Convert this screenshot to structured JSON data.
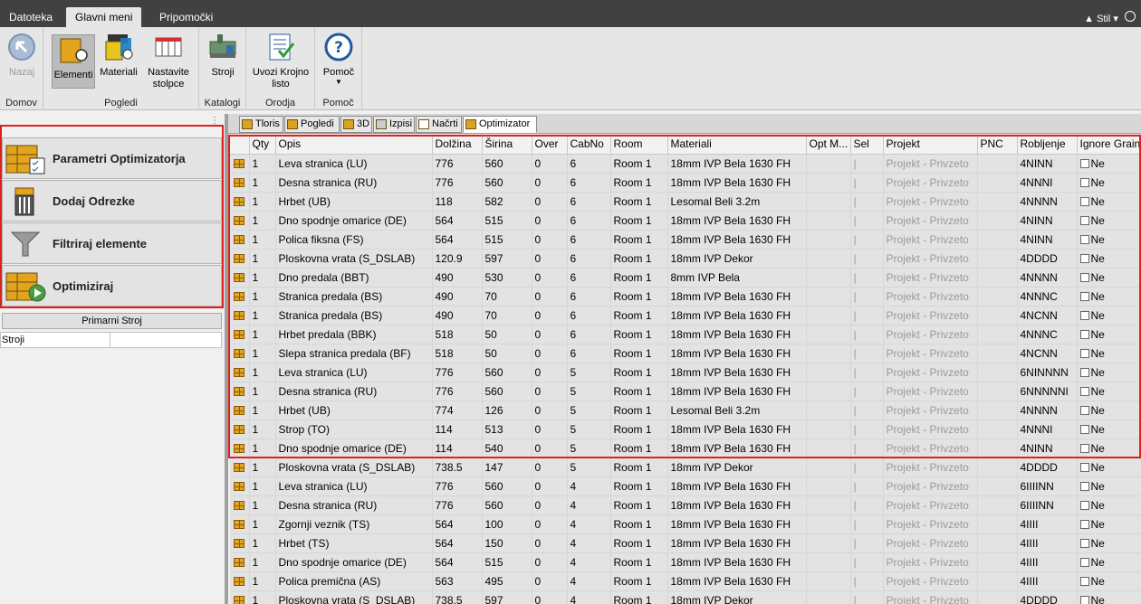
{
  "menubar": {
    "tabs": [
      {
        "label": "Datoteka",
        "active": false
      },
      {
        "label": "Glavni meni",
        "active": true
      },
      {
        "label": "Pripomočki",
        "active": false
      }
    ],
    "style_label": "Stil"
  },
  "ribbon": {
    "groups": [
      {
        "label": "Domov",
        "buttons": [
          {
            "label": "Nazaj",
            "icon": "back-arrow-icon",
            "disabled": true
          }
        ]
      },
      {
        "label": "Pogledi",
        "buttons": [
          {
            "label": "Elementi",
            "icon": "elements-icon",
            "selected": true
          },
          {
            "label": "Materiali",
            "icon": "materials-icon"
          },
          {
            "label": "Nastavite stolpce",
            "icon": "columns-icon"
          }
        ]
      },
      {
        "label": "Katalogi",
        "buttons": [
          {
            "label": "Stroji",
            "icon": "machine-icon"
          }
        ]
      },
      {
        "label": "Orodja",
        "buttons": [
          {
            "label": "Uvozi Krojno listo",
            "icon": "import-list-icon"
          }
        ]
      },
      {
        "label": "Pomoč",
        "buttons": [
          {
            "label": "Pomoč",
            "icon": "help-icon"
          }
        ]
      }
    ]
  },
  "leftpanel": {
    "buttons": [
      {
        "label": "Parametri Optimizatorja",
        "icon": "optimizer-params-icon"
      },
      {
        "label": "Dodaj Odrezke",
        "icon": "add-offcuts-icon"
      },
      {
        "label": "Filtriraj elemente",
        "icon": "filter-icon"
      },
      {
        "label": "Optimiziraj",
        "icon": "optimize-play-icon"
      }
    ],
    "primary_machine_label": "Primarni Stroj",
    "machines_header": "Stroji"
  },
  "view_tabs": [
    {
      "label": "Tloris",
      "active": false
    },
    {
      "label": "Pogledi",
      "active": false
    },
    {
      "label": "3D",
      "active": false
    },
    {
      "label": "Izpisi",
      "active": false
    },
    {
      "label": "Načrti",
      "active": false
    },
    {
      "label": "Optimizator",
      "active": true
    }
  ],
  "grid": {
    "columns": [
      "",
      "Qty",
      "Opis",
      "Dolžina",
      "Širina",
      "Over",
      "CabNo",
      "Room",
      "Materiali",
      "Opt M...",
      "Sel",
      "Projekt",
      "PNC",
      "Robljenje",
      "Ignore Grain"
    ],
    "checkbox_label": "Ne",
    "sel_mark": "|",
    "rows": [
      [
        "1",
        "Leva stranica (LU)",
        "776",
        "560",
        "0",
        "6",
        "Room 1",
        "18mm IVP Bela 1630 FH",
        "",
        "Projekt - Privzeto",
        "",
        "4NINN"
      ],
      [
        "1",
        "Desna stranica (RU)",
        "776",
        "560",
        "0",
        "6",
        "Room 1",
        "18mm IVP Bela 1630 FH",
        "",
        "Projekt - Privzeto",
        "",
        "4NNNI"
      ],
      [
        "1",
        "Hrbet (UB)",
        "118",
        "582",
        "0",
        "6",
        "Room 1",
        "Lesomal Beli 3.2m",
        "",
        "Projekt - Privzeto",
        "",
        "4NNNN"
      ],
      [
        "1",
        "Dno spodnje omarice (DE)",
        "564",
        "515",
        "0",
        "6",
        "Room 1",
        "18mm IVP Bela 1630 FH",
        "",
        "Projekt - Privzeto",
        "",
        "4NINN"
      ],
      [
        "1",
        "Polica fiksna (FS)",
        "564",
        "515",
        "0",
        "6",
        "Room 1",
        "18mm IVP Bela 1630 FH",
        "",
        "Projekt - Privzeto",
        "",
        "4NINN"
      ],
      [
        "1",
        "Ploskovna vrata (S_DSLAB)",
        "120.9",
        "597",
        "0",
        "6",
        "Room 1",
        "18mm IVP Dekor",
        "",
        "Projekt - Privzeto",
        "",
        "4DDDD"
      ],
      [
        "1",
        "Dno predala (BBT)",
        "490",
        "530",
        "0",
        "6",
        "Room 1",
        "8mm IVP Bela",
        "",
        "Projekt - Privzeto",
        "",
        "4NNNN"
      ],
      [
        "1",
        "Stranica predala (BS)",
        "490",
        "70",
        "0",
        "6",
        "Room 1",
        "18mm IVP Bela 1630 FH",
        "",
        "Projekt - Privzeto",
        "",
        "4NNNC"
      ],
      [
        "1",
        "Stranica predala (BS)",
        "490",
        "70",
        "0",
        "6",
        "Room 1",
        "18mm IVP Bela 1630 FH",
        "",
        "Projekt - Privzeto",
        "",
        "4NCNN"
      ],
      [
        "1",
        "Hrbet predala (BBK)",
        "518",
        "50",
        "0",
        "6",
        "Room 1",
        "18mm IVP Bela 1630 FH",
        "",
        "Projekt - Privzeto",
        "",
        "4NNNC"
      ],
      [
        "1",
        "Slepa stranica predala (BF)",
        "518",
        "50",
        "0",
        "6",
        "Room 1",
        "18mm IVP Bela 1630 FH",
        "",
        "Projekt - Privzeto",
        "",
        "4NCNN"
      ],
      [
        "1",
        "Leva stranica (LU)",
        "776",
        "560",
        "0",
        "5",
        "Room 1",
        "18mm IVP Bela 1630 FH",
        "",
        "Projekt - Privzeto",
        "",
        "6NINNNN"
      ],
      [
        "1",
        "Desna stranica (RU)",
        "776",
        "560",
        "0",
        "5",
        "Room 1",
        "18mm IVP Bela 1630 FH",
        "",
        "Projekt - Privzeto",
        "",
        "6NNNNNI"
      ],
      [
        "1",
        "Hrbet (UB)",
        "774",
        "126",
        "0",
        "5",
        "Room 1",
        "Lesomal Beli 3.2m",
        "",
        "Projekt - Privzeto",
        "",
        "4NNNN"
      ],
      [
        "1",
        "Strop (TO)",
        "114",
        "513",
        "0",
        "5",
        "Room 1",
        "18mm IVP Bela 1630 FH",
        "",
        "Projekt - Privzeto",
        "",
        "4NNNI"
      ],
      [
        "1",
        "Dno spodnje omarice (DE)",
        "114",
        "540",
        "0",
        "5",
        "Room 1",
        "18mm IVP Bela 1630 FH",
        "",
        "Projekt - Privzeto",
        "",
        "4NINN"
      ],
      [
        "1",
        "Ploskovna vrata (S_DSLAB)",
        "738.5",
        "147",
        "0",
        "5",
        "Room 1",
        "18mm IVP Dekor",
        "",
        "Projekt - Privzeto",
        "",
        "4DDDD"
      ],
      [
        "1",
        "Leva stranica (LU)",
        "776",
        "560",
        "0",
        "4",
        "Room 1",
        "18mm IVP Bela 1630 FH",
        "",
        "Projekt - Privzeto",
        "",
        "6IIIINN"
      ],
      [
        "1",
        "Desna stranica (RU)",
        "776",
        "560",
        "0",
        "4",
        "Room 1",
        "18mm IVP Bela 1630 FH",
        "",
        "Projekt - Privzeto",
        "",
        "6IIIINN"
      ],
      [
        "1",
        "Zgornji veznik (TS)",
        "564",
        "100",
        "0",
        "4",
        "Room 1",
        "18mm IVP Bela 1630 FH",
        "",
        "Projekt - Privzeto",
        "",
        "4IIII"
      ],
      [
        "1",
        "Hrbet  (TS)",
        "564",
        "150",
        "0",
        "4",
        "Room 1",
        "18mm IVP Bela 1630 FH",
        "",
        "Projekt - Privzeto",
        "",
        "4IIII"
      ],
      [
        "1",
        "Dno spodnje omarice (DE)",
        "564",
        "515",
        "0",
        "4",
        "Room 1",
        "18mm IVP Bela 1630 FH",
        "",
        "Projekt - Privzeto",
        "",
        "4IIII"
      ],
      [
        "1",
        "Polica premična (AS)",
        "563",
        "495",
        "0",
        "4",
        "Room 1",
        "18mm IVP Bela 1630 FH",
        "",
        "Projekt - Privzeto",
        "",
        "4IIII"
      ],
      [
        "1",
        "Ploskovna vrata (S_DSLAB)",
        "738.5",
        "597",
        "0",
        "4",
        "Room 1",
        "18mm IVP Dekor",
        "",
        "Projekt - Privzeto",
        "",
        "4DDDD"
      ]
    ]
  },
  "colors": {
    "highlight": "#e0201f",
    "menubar": "#414141",
    "row_icon": "#e2a41e"
  }
}
